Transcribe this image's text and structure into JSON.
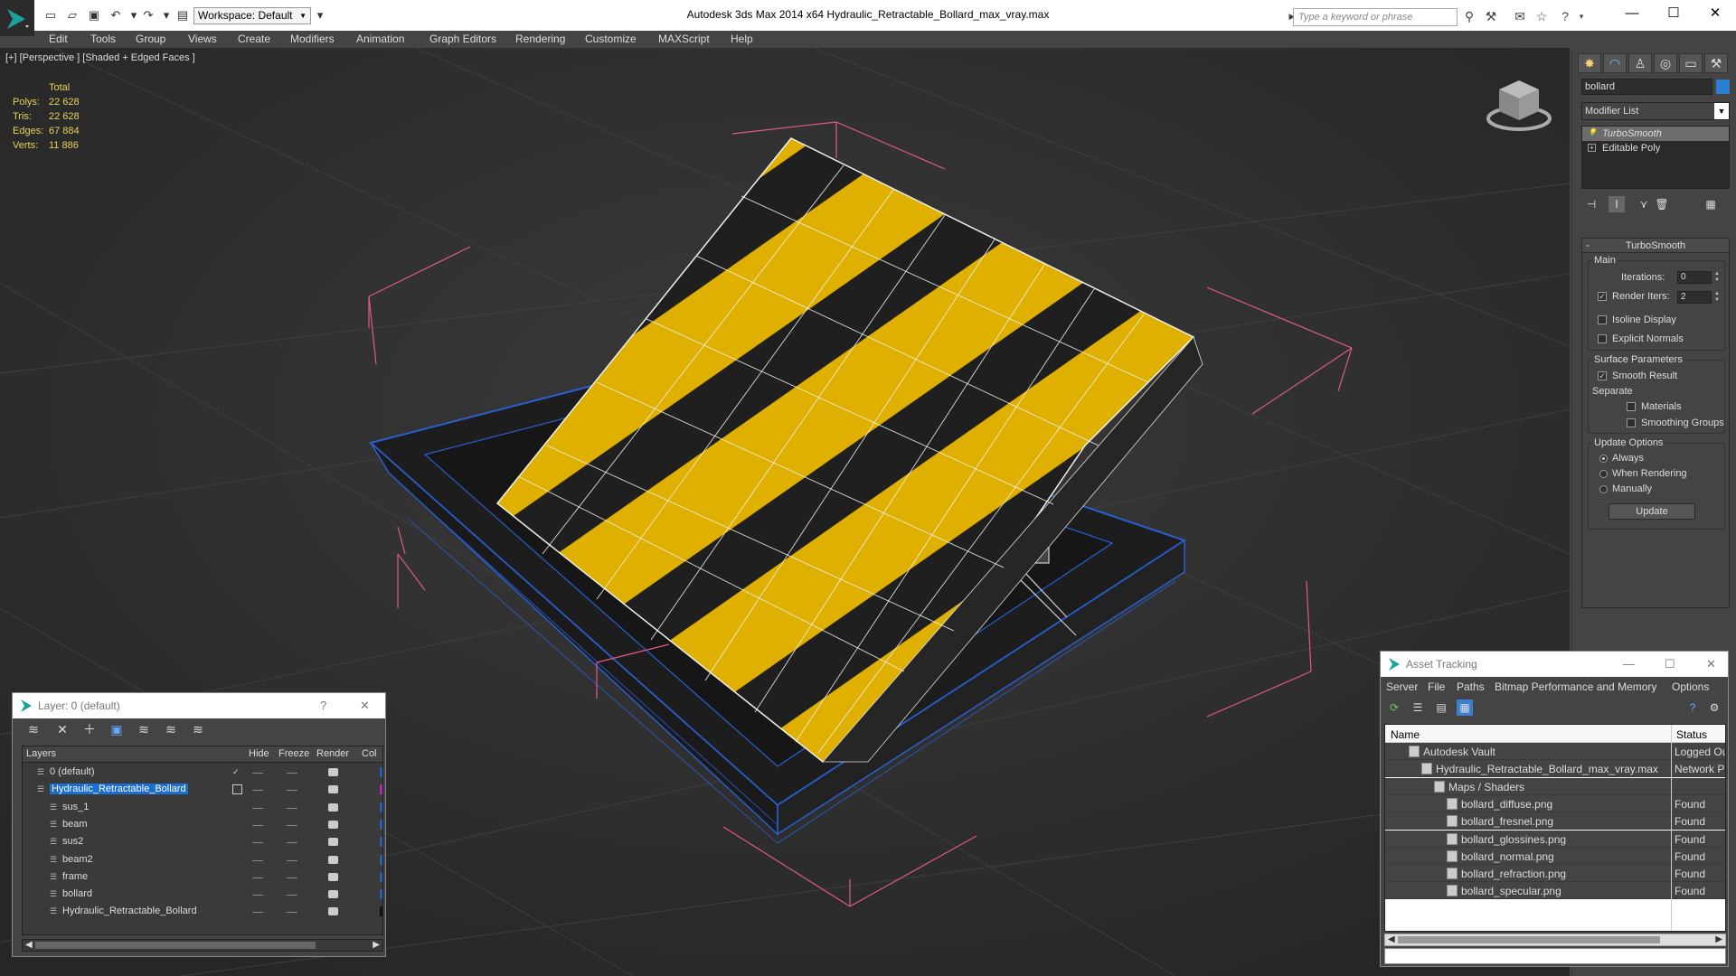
{
  "app": {
    "title": "Autodesk 3ds Max  2014 x64      Hydraulic_Retractable_Bollard_max_vray.max",
    "workspace": "Workspace: Default",
    "search_placeholder": "Type a keyword or phrase"
  },
  "menu": [
    "Edit",
    "Tools",
    "Group",
    "Views",
    "Create",
    "Modifiers",
    "Animation",
    "Graph Editors",
    "Rendering",
    "Customize",
    "MAXScript",
    "Help"
  ],
  "viewport": {
    "label": "[+] [Perspective ] [Shaded + Edged Faces ]",
    "stats": {
      "header": "Total",
      "rows": [
        {
          "k": "Polys:",
          "v": "22 628"
        },
        {
          "k": "Tris:",
          "v": "22 628"
        },
        {
          "k": "Edges:",
          "v": "67 884"
        },
        {
          "k": "Verts:",
          "v": "11 886"
        }
      ]
    }
  },
  "command_panel": {
    "object_name": "bollard",
    "object_color": "#2a7fd0",
    "modifier_list": "Modifier List",
    "stack": [
      "TurboSmooth",
      "Editable Poly"
    ],
    "rollout_title": "TurboSmooth",
    "main_group": "Main",
    "iterations_label": "Iterations:",
    "iterations_value": "0",
    "render_iters_label": "Render Iters:",
    "render_iters_value": "2",
    "isoline": "Isoline Display",
    "explicit": "Explicit Normals",
    "surface_group": "Surface Parameters",
    "smooth_result": "Smooth Result",
    "separate": "Separate",
    "materials": "Materials",
    "smoothing_groups": "Smoothing Groups",
    "update_group": "Update Options",
    "always": "Always",
    "when_rendering": "When Rendering",
    "manually": "Manually",
    "update_button": "Update"
  },
  "layer_window": {
    "title": "Layer: 0 (default)",
    "help": "?",
    "close": "✕",
    "columns": [
      "Layers",
      "Hide",
      "Freeze",
      "Render",
      "Col"
    ],
    "rows": [
      {
        "name": "0 (default)",
        "indent": 1,
        "color": "#2a5fb0",
        "check": "✓"
      },
      {
        "name": "Hydraulic_Retractable_Bollard",
        "indent": 1,
        "color": "#b02aa0",
        "selected": true
      },
      {
        "name": "sus_1",
        "indent": 2,
        "color": "#2a5fb0"
      },
      {
        "name": "beam",
        "indent": 2,
        "color": "#2a5fb0"
      },
      {
        "name": "sus2",
        "indent": 2,
        "color": "#2a5fb0"
      },
      {
        "name": "beam2",
        "indent": 2,
        "color": "#2a5fb0"
      },
      {
        "name": "frame",
        "indent": 2,
        "color": "#2a5fb0"
      },
      {
        "name": "bollard",
        "indent": 2,
        "color": "#2a5fb0"
      },
      {
        "name": "Hydraulic_Retractable_Bollard",
        "indent": 2,
        "color": "#111111"
      }
    ]
  },
  "asset_window": {
    "title": "Asset Tracking",
    "menu": [
      "Server",
      "File",
      "Paths",
      "Bitmap Performance and Memory",
      "Options"
    ],
    "columns": [
      "Name",
      "Status"
    ],
    "rows": [
      {
        "name": "Autodesk Vault",
        "indent": 1,
        "status": "Logged Ou"
      },
      {
        "name": "Hydraulic_Retractable_Bollard_max_vray.max",
        "indent": 2,
        "status": "Network Pa"
      },
      {
        "name": "Maps / Shaders",
        "indent": 3,
        "status": ""
      },
      {
        "name": "bollard_diffuse.png",
        "indent": 4,
        "status": "Found"
      },
      {
        "name": "bollard_fresnel.png",
        "indent": 4,
        "status": "Found"
      },
      {
        "name": "bollard_glossines.png",
        "indent": 4,
        "status": "Found"
      },
      {
        "name": "bollard_normal.png",
        "indent": 4,
        "status": "Found"
      },
      {
        "name": "bollard_refraction.png",
        "indent": 4,
        "status": "Found"
      },
      {
        "name": "bollard_specular.png",
        "indent": 4,
        "status": "Found"
      }
    ]
  }
}
